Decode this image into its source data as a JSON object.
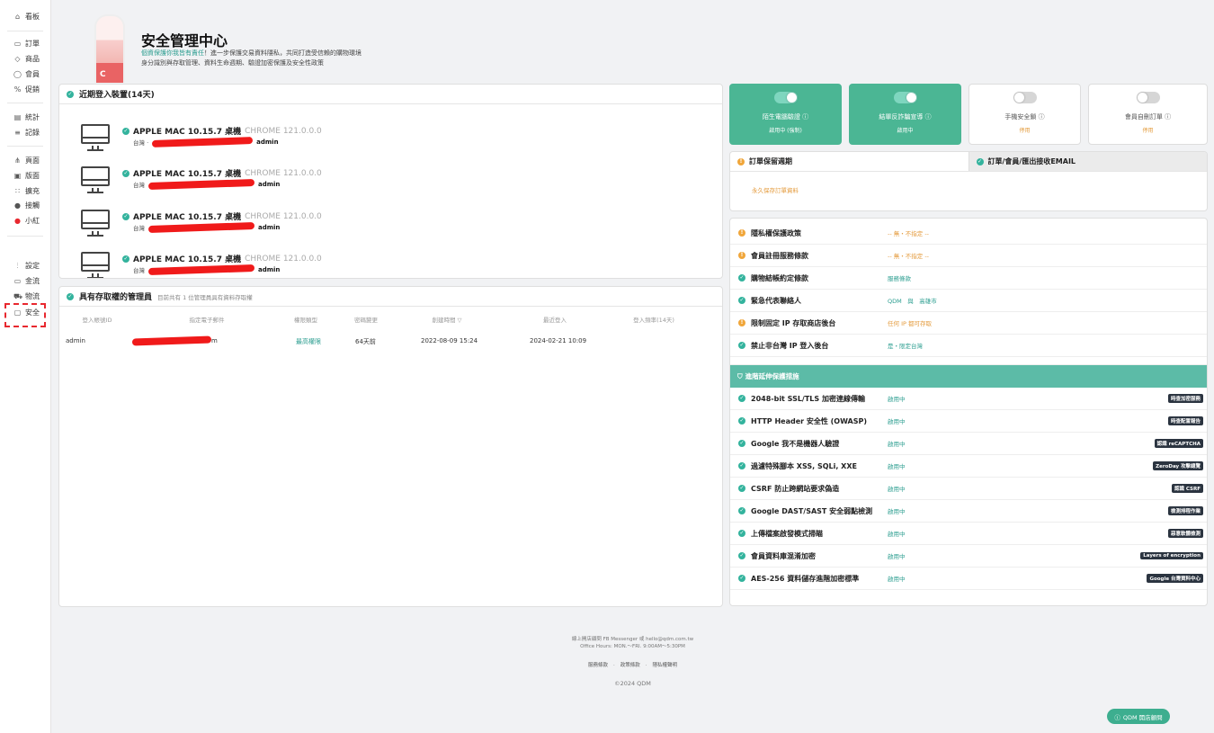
{
  "sidebar": {
    "items": [
      {
        "label": "看板",
        "icon": "home-icon"
      },
      {
        "label": "訂單",
        "icon": "order-icon"
      },
      {
        "label": "商品",
        "icon": "tag-icon"
      },
      {
        "label": "會員",
        "icon": "user-icon"
      },
      {
        "label": "促銷",
        "icon": "percent-icon"
      },
      {
        "label": "統計",
        "icon": "chart-icon"
      },
      {
        "label": "記錄",
        "icon": "log-icon"
      },
      {
        "label": "頁面",
        "icon": "sitemap-icon"
      },
      {
        "label": "版面",
        "icon": "layout-icon"
      },
      {
        "label": "擴充",
        "icon": "grid-icon"
      },
      {
        "label": "接觸",
        "icon": "contact-icon"
      },
      {
        "label": "小紅",
        "icon": "xiaohongshu-icon"
      },
      {
        "label": "設定",
        "icon": "sliders-icon"
      },
      {
        "label": "金流",
        "icon": "card-icon"
      },
      {
        "label": "物流",
        "icon": "truck-icon"
      },
      {
        "label": "安全",
        "icon": "lock-icon"
      }
    ]
  },
  "header": {
    "logo_letter": "C",
    "title": "安全管理中心",
    "sub1_highlight": "個資保護你我皆有責任",
    "sub1_rest": "！進一步保護交易資料隱私，共同打造受信賴的購物環境",
    "sub2": "身分識別與存取管理、資料生命週期、驗證加密保護及安全性政策"
  },
  "devices": {
    "title": "近期登入裝置(14天)",
    "items": [
      {
        "os": "APPLE MAC 10.15.7 桌機",
        "browser": "CHROME 121.0.0.0",
        "region": "台灣 ·",
        "user": "admin"
      },
      {
        "os": "APPLE MAC 10.15.7 桌機",
        "browser": "CHROME 121.0.0.0",
        "region": "台灣",
        "user": "admin"
      },
      {
        "os": "APPLE MAC 10.15.7 桌機",
        "browser": "CHROME 121.0.0.0",
        "region": "台灣",
        "user": "admin"
      },
      {
        "os": "APPLE MAC 10.15.7 桌機",
        "browser": "CHROME 121.0.0.0",
        "region": "台灣",
        "user": "admin"
      }
    ]
  },
  "admins": {
    "title": "具有存取權的管理員",
    "note": "目前共有 1 位管理員具有資料存取權",
    "columns": [
      "登入帳號ID",
      "指定電子郵件",
      "權限類型",
      "密碼變更",
      "創建時間 ▽",
      "最近登入",
      "登入頻率(14天)"
    ],
    "rows": [
      {
        "id": "admin",
        "email_suffix": "m",
        "role": "最高權限",
        "pw": "64天前",
        "created": "2022-08-09 15:24",
        "last": "2024-02-21 10:09"
      }
    ]
  },
  "toggles": [
    {
      "label": "陌生電腦驗證 ⓘ",
      "status": "啟用中 (強制)",
      "on": true
    },
    {
      "label": "結單反詐騙宣導 ⓘ",
      "status": "啟用中",
      "on": true
    },
    {
      "label": "手機安全鎖 ⓘ",
      "status": "停用",
      "on": false
    },
    {
      "label": "會員自刪訂單 ⓘ",
      "status": "停用",
      "on": false
    }
  ],
  "retention": {
    "tab1": "訂單保留週期",
    "tab2": "訂單/會員/匯出接收EMAIL",
    "value": "永久保存訂單資料"
  },
  "policies": [
    {
      "label": "隱私權保護政策",
      "value": "-- 無・不指定 --",
      "state": "warn"
    },
    {
      "label": "會員註冊服務條款",
      "value": "-- 無・不指定 --",
      "state": "warn"
    },
    {
      "label": "購物結帳約定條款",
      "value": "服務條款",
      "state": "ok"
    },
    {
      "label": "緊急代表聯絡人",
      "value": "QDM　與　高雄市",
      "state": "ok"
    },
    {
      "label": "限制固定 IP 存取商店後台",
      "value": "任何 IP 都可存取",
      "state": "warn"
    },
    {
      "label": "禁止非台灣 IP 登入後台",
      "value": "是・限定台灣",
      "state": "ok"
    }
  ],
  "extended": {
    "title": "進階延伸保護措施",
    "items": [
      {
        "label": "2048-bit SSL/TLS 加密連線傳輸",
        "value": "啟用中",
        "badge": "時查加密服務"
      },
      {
        "label": "HTTP Header 安全性 (OWASP)",
        "value": "啟用中",
        "badge": "時查配置報告"
      },
      {
        "label": "Google 我不是機器人驗證",
        "value": "啟用中",
        "badge": "認識 reCAPTCHA"
      },
      {
        "label": "過濾特殊腳本 XSS, SQLi, XXE",
        "value": "啟用中",
        "badge": "ZeroDay 攻擊總覽"
      },
      {
        "label": "CSRF 防止跨網站要求偽造",
        "value": "啟用中",
        "badge": "認識 CSRF"
      },
      {
        "label": "Google DAST/SAST 安全弱點檢測",
        "value": "啟用中",
        "badge": "檢測排程作業"
      },
      {
        "label": "上傳檔案啟發模式掃瞄",
        "value": "啟用中",
        "badge": "惡意軟體檢測"
      },
      {
        "label": "會員資料庫混淆加密",
        "value": "啟用中",
        "badge": "Layers of encryption"
      },
      {
        "label": "AES-256 資料儲存進階加密標準",
        "value": "啟用中",
        "badge": "Google 台灣資料中心"
      }
    ]
  },
  "footer": {
    "line1": "線上開店顧問 FB Messenger 或 hello@qdm.com.tw",
    "line2": "Office Hours: MON.～FRI. 9:00AM～5:30PM",
    "links": [
      "服務條款",
      "政策條款",
      "隱私權聲明"
    ],
    "copyright": "©2024 QDM"
  },
  "fab": {
    "label": "QDM 開店顧問",
    "icon": "question-icon"
  }
}
